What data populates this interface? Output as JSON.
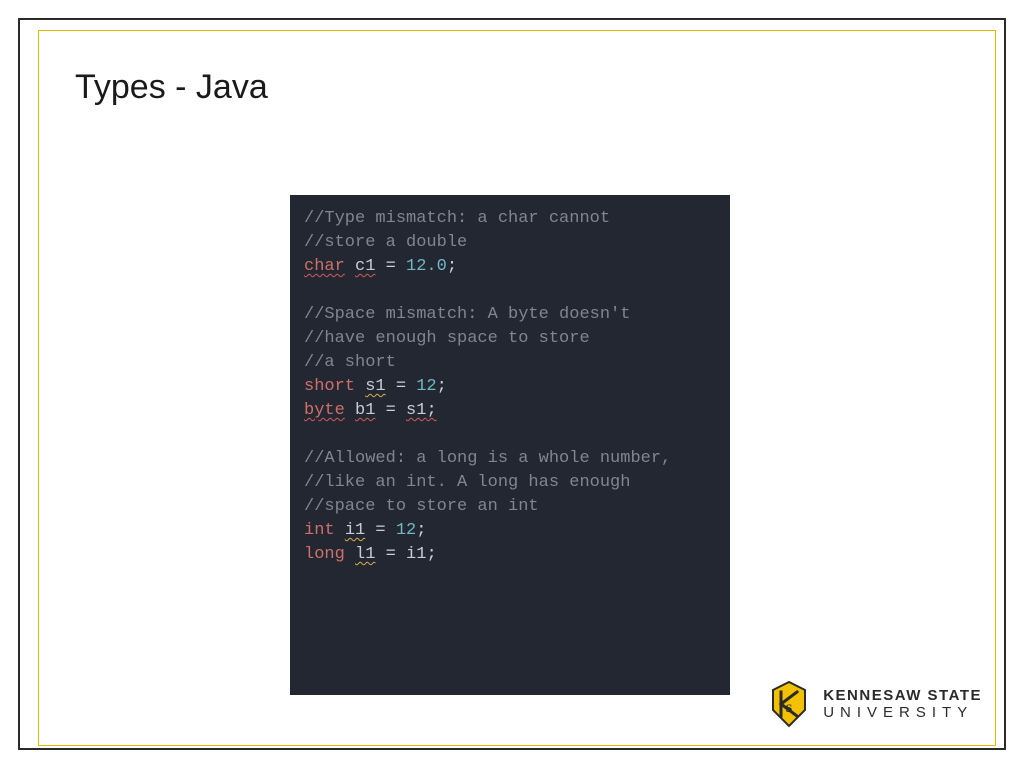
{
  "title": "Types - Java",
  "code": {
    "c1_a": "//Type mismatch: a char cannot",
    "c1_b": "//store a double",
    "l1_kw": "char",
    "l1_id": "c1",
    "l1_eq": " = ",
    "l1_val": "12.0",
    "l1_end": ";",
    "c2_a": "//Space mismatch: A byte doesn't",
    "c2_b": "//have enough space to store",
    "c2_c": "//a short",
    "l2_kw": "short",
    "l2_id": "s1",
    "l2_eq": " = ",
    "l2_val": "12",
    "l2_end": ";",
    "l3_kw": "byte",
    "l3_id": "b1",
    "l3_eq": " = ",
    "l3_rhs": "s1",
    "l3_end": ";",
    "c3_a": "//Allowed: a long is a whole number,",
    "c3_b": "//like an int. A long has enough",
    "c3_c": "//space to store an int",
    "l4_kw": "int",
    "l4_id": "i1",
    "l4_eq": " = ",
    "l4_val": "12",
    "l4_end": ";",
    "l5_kw": "long",
    "l5_id": "l1",
    "l5_eq": " = ",
    "l5_rhs": "i1",
    "l5_end": ";"
  },
  "logo": {
    "line1": "KENNESAW STATE",
    "line2": "UNIVERSITY"
  },
  "colors": {
    "accent": "#e6b800",
    "frame": "#2b2b2b",
    "codeBg": "#232731"
  }
}
